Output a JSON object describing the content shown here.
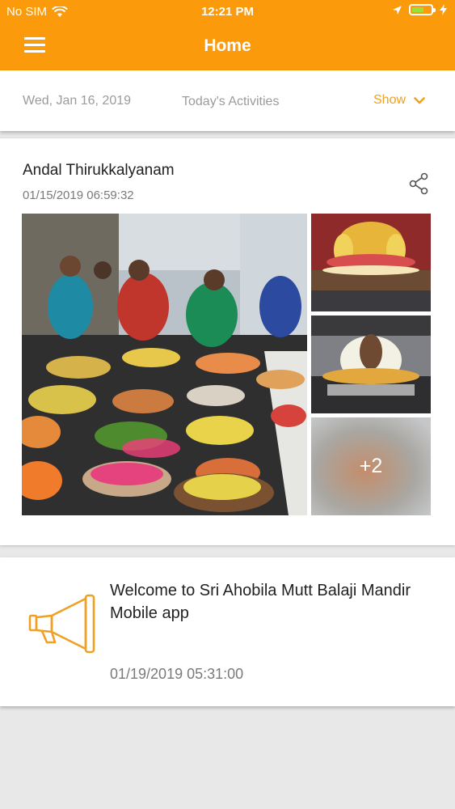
{
  "status_bar": {
    "carrier": "No SIM",
    "time": "12:21 PM",
    "battery_color": "#9ae03c"
  },
  "header": {
    "title": "Home",
    "menu_icon": "hamburger-menu-icon",
    "background": "#fb9a0b"
  },
  "date_bar": {
    "date": "Wed, Jan 16, 2019",
    "label": "Today's Activities",
    "show_label": "Show",
    "accent": "#f0a023"
  },
  "post": {
    "title": "Andal Thirukkalyanam",
    "timestamp": "01/15/2019 06:59:32",
    "share_icon": "share-icon",
    "more_photos_label": "+2"
  },
  "announcement": {
    "icon": "megaphone-icon",
    "message": "Welcome to Sri Ahobila Mutt Balaji Mandir Mobile app",
    "timestamp": "01/19/2019 05:31:00"
  }
}
